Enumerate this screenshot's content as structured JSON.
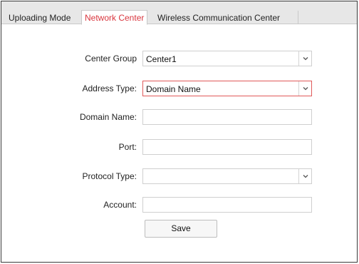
{
  "tabs": [
    {
      "label": "Uploading Mode",
      "active": false
    },
    {
      "label": "Network Center",
      "active": true
    },
    {
      "label": "Wireless Communication Center",
      "active": false
    }
  ],
  "form": {
    "center_group": {
      "label": "Center Group",
      "value": "Center1"
    },
    "address_type": {
      "label": "Address Type:",
      "value": "Domain Name"
    },
    "domain_name": {
      "label": "Domain Name:",
      "value": ""
    },
    "port": {
      "label": "Port:",
      "value": ""
    },
    "protocol_type": {
      "label": "Protocol Type:",
      "value": ""
    },
    "account": {
      "label": "Account:",
      "value": ""
    }
  },
  "save_label": "Save",
  "colors": {
    "active_tab_text": "#d9363e",
    "focused_field_border": "#e05a5a",
    "tabbar_bg": "#e7e7e7"
  },
  "icons": {
    "dropdown": "chevron-down-icon"
  }
}
